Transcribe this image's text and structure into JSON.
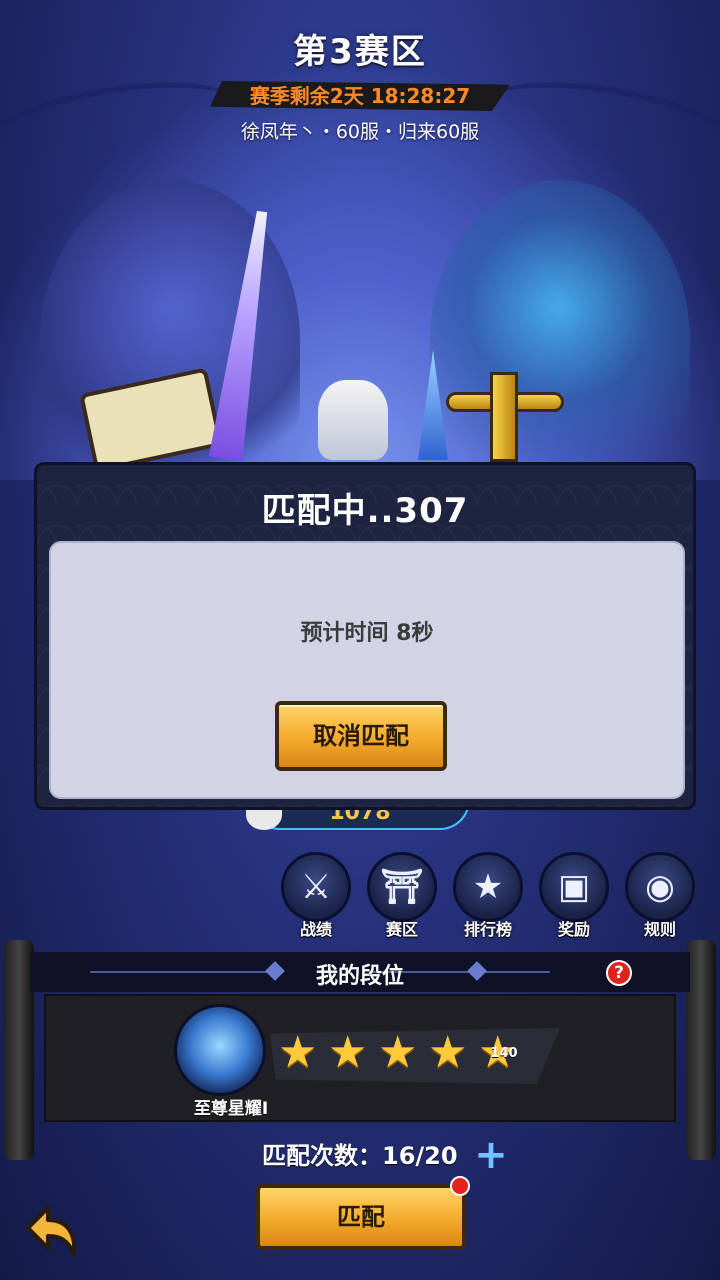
{
  "header": {
    "zone_title": "第3赛区",
    "season_remaining": "赛季剩余2天 18:28:27",
    "server_line": "徐凤年丶・60服・归来60服"
  },
  "match_modal": {
    "title": "匹配中..307",
    "eta": "预计时间 8秒",
    "cancel_label": "取消匹配"
  },
  "score": "1078",
  "menu": [
    {
      "label": "战绩",
      "icon": "record-icon"
    },
    {
      "label": "赛区",
      "icon": "zone-icon"
    },
    {
      "label": "排行榜",
      "icon": "leaderboard-icon"
    },
    {
      "label": "奖励",
      "icon": "reward-chest-icon"
    },
    {
      "label": "规则",
      "icon": "rules-icon"
    }
  ],
  "my_rank": {
    "title": "我的段位",
    "rank_name": "至尊星耀Ⅰ",
    "stars": 5,
    "star_count": "140"
  },
  "bottom": {
    "match_count": "匹配次数：16/20",
    "match_label": "匹配"
  },
  "colors": {
    "accent_gold": "#f3aa2b",
    "season_orange": "#ff8a2a",
    "help_red": "#d9251d"
  }
}
